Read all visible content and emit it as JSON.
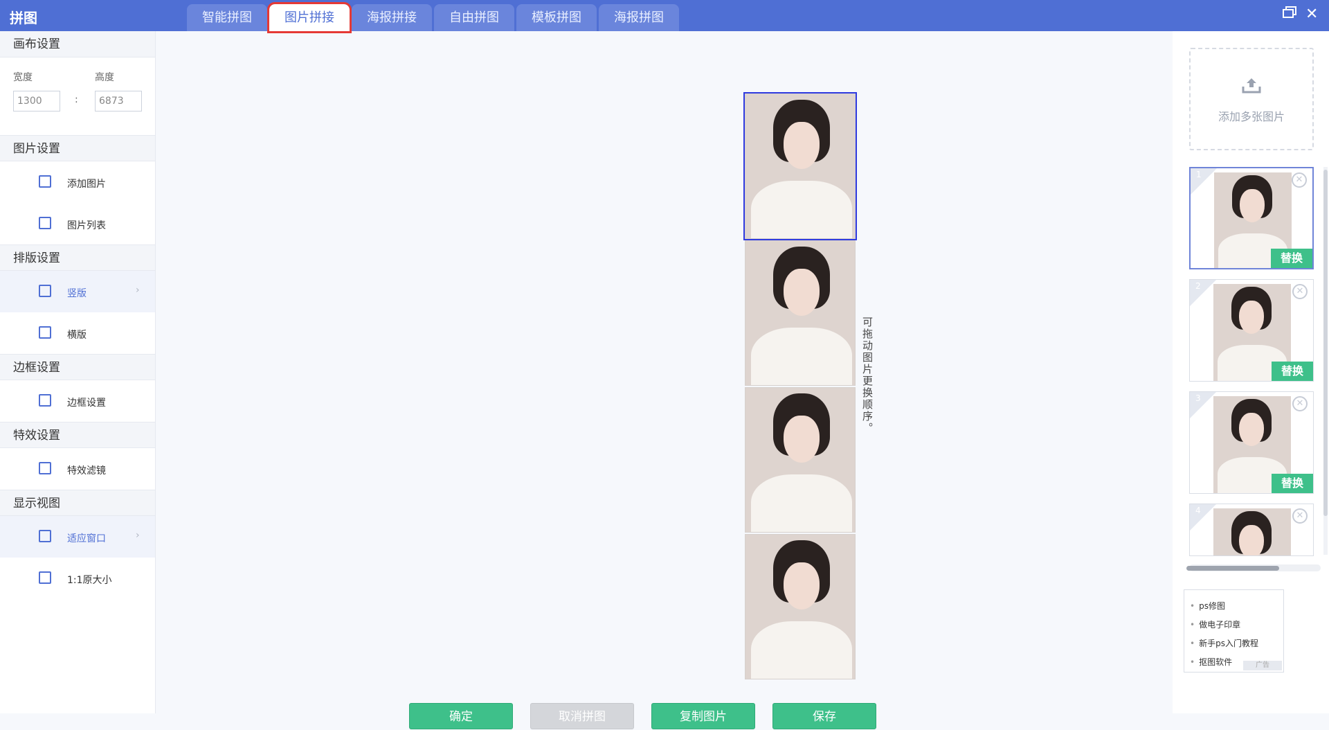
{
  "app": {
    "title": "拼图"
  },
  "tabs": [
    {
      "label": "智能拼图"
    },
    {
      "label": "图片拼接"
    },
    {
      "label": "海报拼接"
    },
    {
      "label": "自由拼图"
    },
    {
      "label": "模板拼图"
    },
    {
      "label": "海报拼图"
    }
  ],
  "window": {
    "restore_icon": "restore-icon",
    "close_glyph": "✕"
  },
  "sidebar": {
    "canvas": {
      "title": "画布设置",
      "width_label": "宽度",
      "height_label": "高度",
      "width_value": "1300",
      "height_value": "6873",
      "separator": ":"
    },
    "image": {
      "title": "图片设置",
      "items": [
        {
          "label": "添加图片"
        },
        {
          "label": "图片列表"
        }
      ]
    },
    "layout": {
      "title": "排版设置",
      "items": [
        {
          "label": "竖版"
        },
        {
          "label": "横版"
        }
      ]
    },
    "border": {
      "title": "边框设置",
      "items": [
        {
          "label": "边框设置"
        }
      ]
    },
    "effects": {
      "title": "特效设置",
      "items": [
        {
          "label": "特效滤镜"
        }
      ]
    },
    "view": {
      "title": "显示视图",
      "items": [
        {
          "label": "适应窗口"
        },
        {
          "label": "1:1原大小"
        }
      ]
    }
  },
  "canvas": {
    "hint": "可拖动图片更换顺序。"
  },
  "actions": {
    "confirm": "确定",
    "cancel": "取消拼图",
    "copy": "复制图片",
    "save": "保存"
  },
  "rightpanel": {
    "add_multi": "添加多张图片",
    "thumbs": [
      {
        "num": "1",
        "replace": "替换"
      },
      {
        "num": "2",
        "replace": "替换"
      },
      {
        "num": "3",
        "replace": "替换"
      },
      {
        "num": "4"
      }
    ]
  },
  "ad": {
    "items": [
      "ps修图",
      "做电子印章",
      "新手ps入门教程",
      "抠图软件"
    ],
    "tag": "广告"
  }
}
